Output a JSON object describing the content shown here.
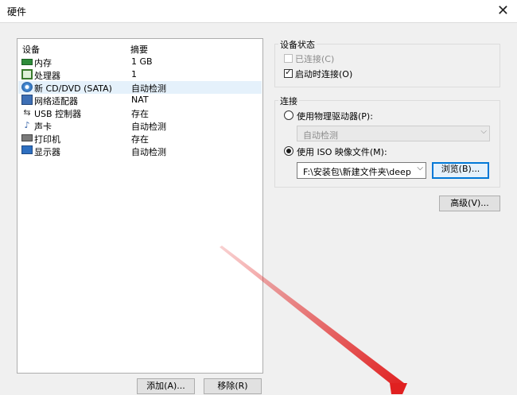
{
  "window": {
    "title": "硬件",
    "close_glyph": "✕"
  },
  "hardware_list": {
    "headers": {
      "device": "设备",
      "summary": "摘要"
    },
    "items": [
      {
        "name": "内存",
        "summary": "1 GB",
        "icon": "memory-icon"
      },
      {
        "name": "处理器",
        "summary": "1",
        "icon": "cpu-icon"
      },
      {
        "name": "新 CD/DVD (SATA)",
        "summary": "自动检测",
        "icon": "cd-dvd-icon",
        "selected": true
      },
      {
        "name": "网络适配器",
        "summary": "NAT",
        "icon": "network-adapter-icon"
      },
      {
        "name": "USB 控制器",
        "summary": "存在",
        "icon": "usb-icon"
      },
      {
        "name": "声卡",
        "summary": "自动检测",
        "icon": "sound-card-icon"
      },
      {
        "name": "打印机",
        "summary": "存在",
        "icon": "printer-icon"
      },
      {
        "name": "显示器",
        "summary": "自动检测",
        "icon": "monitor-icon"
      }
    ],
    "add_button": "添加(A)...",
    "remove_button": "移除(R)"
  },
  "device_status": {
    "label": "设备状态",
    "connected": {
      "label": "已连接(C)",
      "checked": false,
      "disabled": true
    },
    "connect_at_power_on": {
      "label": "启动时连接(O)",
      "checked": true
    }
  },
  "connection": {
    "label": "连接",
    "physical": {
      "label": "使用物理驱动器(P):",
      "selected": false
    },
    "physical_drive_value": "自动检测",
    "iso": {
      "label": "使用 ISO 映像文件(M):",
      "selected": true
    },
    "iso_path": "F:\\安装包\\新建文件夹\\deepin",
    "browse_button": "浏览(B)..."
  },
  "advanced_button": "高级(V)...",
  "colors": {
    "selection": "#e5f1fb",
    "focus": "#0078d7",
    "annotation_arrow": "#e02020"
  },
  "glyphs": {
    "check": "✓",
    "dropdown": "⌵",
    "usb": "⇆",
    "sound": "♪"
  }
}
